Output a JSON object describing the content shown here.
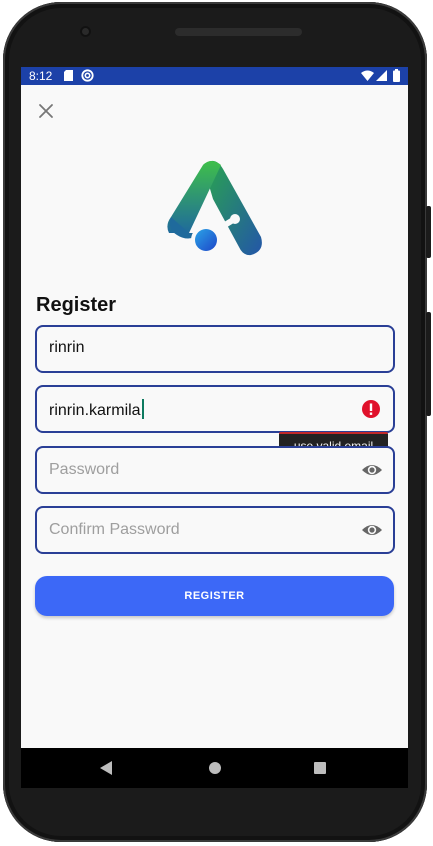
{
  "status_bar": {
    "time": "8:12",
    "icons": [
      "sd-card-icon",
      "vpn-icon",
      "wifi-icon",
      "signal-icon",
      "battery-icon"
    ],
    "color": "#1c41a8"
  },
  "header": {
    "close_icon": "close-icon"
  },
  "form": {
    "title": "Register",
    "name": {
      "value": "rinrin"
    },
    "email": {
      "value": "rinrin.karmila",
      "error": "use valid email"
    },
    "password": {
      "placeholder": "Password"
    },
    "confirm_password": {
      "placeholder": "Confirm Password"
    },
    "submit_label": "REGISTER"
  },
  "colors": {
    "field_border": "#2a3f96",
    "button": "#3c68f7",
    "error": "#e0112b"
  },
  "nav": {
    "icons": [
      "back-icon",
      "home-icon",
      "recents-icon"
    ]
  }
}
